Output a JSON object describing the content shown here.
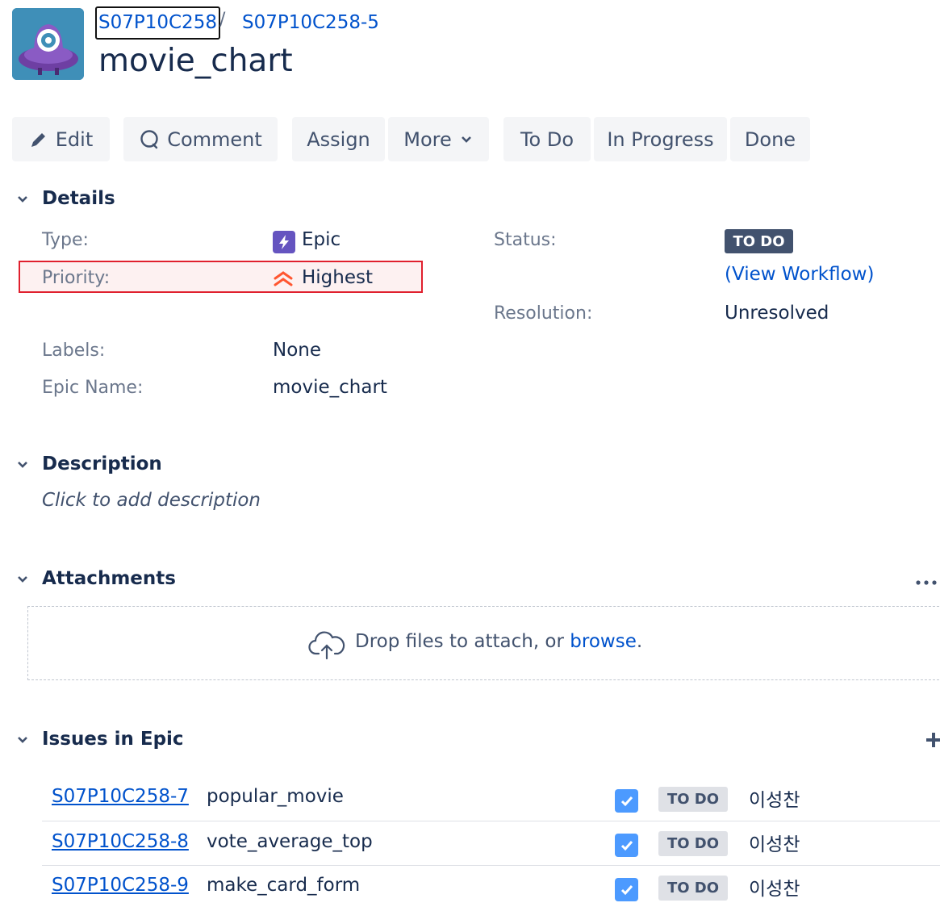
{
  "breadcrumb": {
    "project_key": "S07P10C258",
    "separator": "/",
    "issue_key": "S07P10C258-5"
  },
  "issue": {
    "title": "movie_chart"
  },
  "toolbar": {
    "edit": "Edit",
    "comment": "Comment",
    "assign": "Assign",
    "more": "More",
    "todo": "To Do",
    "in_progress": "In Progress",
    "done": "Done"
  },
  "details": {
    "title": "Details",
    "type_label": "Type:",
    "type_value": "Epic",
    "priority_label": "Priority:",
    "priority_value": "Highest",
    "labels_label": "Labels:",
    "labels_value": "None",
    "epic_name_label": "Epic Name:",
    "epic_name_value": "movie_chart",
    "status_label": "Status:",
    "status_value": "TO DO",
    "view_workflow": "(View Workflow)",
    "resolution_label": "Resolution:",
    "resolution_value": "Unresolved"
  },
  "description": {
    "title": "Description",
    "placeholder": "Click to add description"
  },
  "attachments": {
    "title": "Attachments",
    "drop_text": "Drop files to attach, or",
    "browse": "browse",
    "period": "."
  },
  "issues_in_epic": {
    "title": "Issues in Epic",
    "rows": [
      {
        "key": "S07P10C258-7",
        "summary": "popular_movie",
        "status": "TO DO",
        "assignee": "이성찬"
      },
      {
        "key": "S07P10C258-8",
        "summary": "vote_average_top",
        "status": "TO DO",
        "assignee": "이성찬"
      },
      {
        "key": "S07P10C258-9",
        "summary": "make_card_form",
        "status": "TO DO",
        "assignee": "이성찬"
      }
    ]
  },
  "colors": {
    "link": "#0052cc",
    "epic": "#6554c0",
    "priority_highest": "#ff5630",
    "highlight_border": "#e0202e"
  }
}
